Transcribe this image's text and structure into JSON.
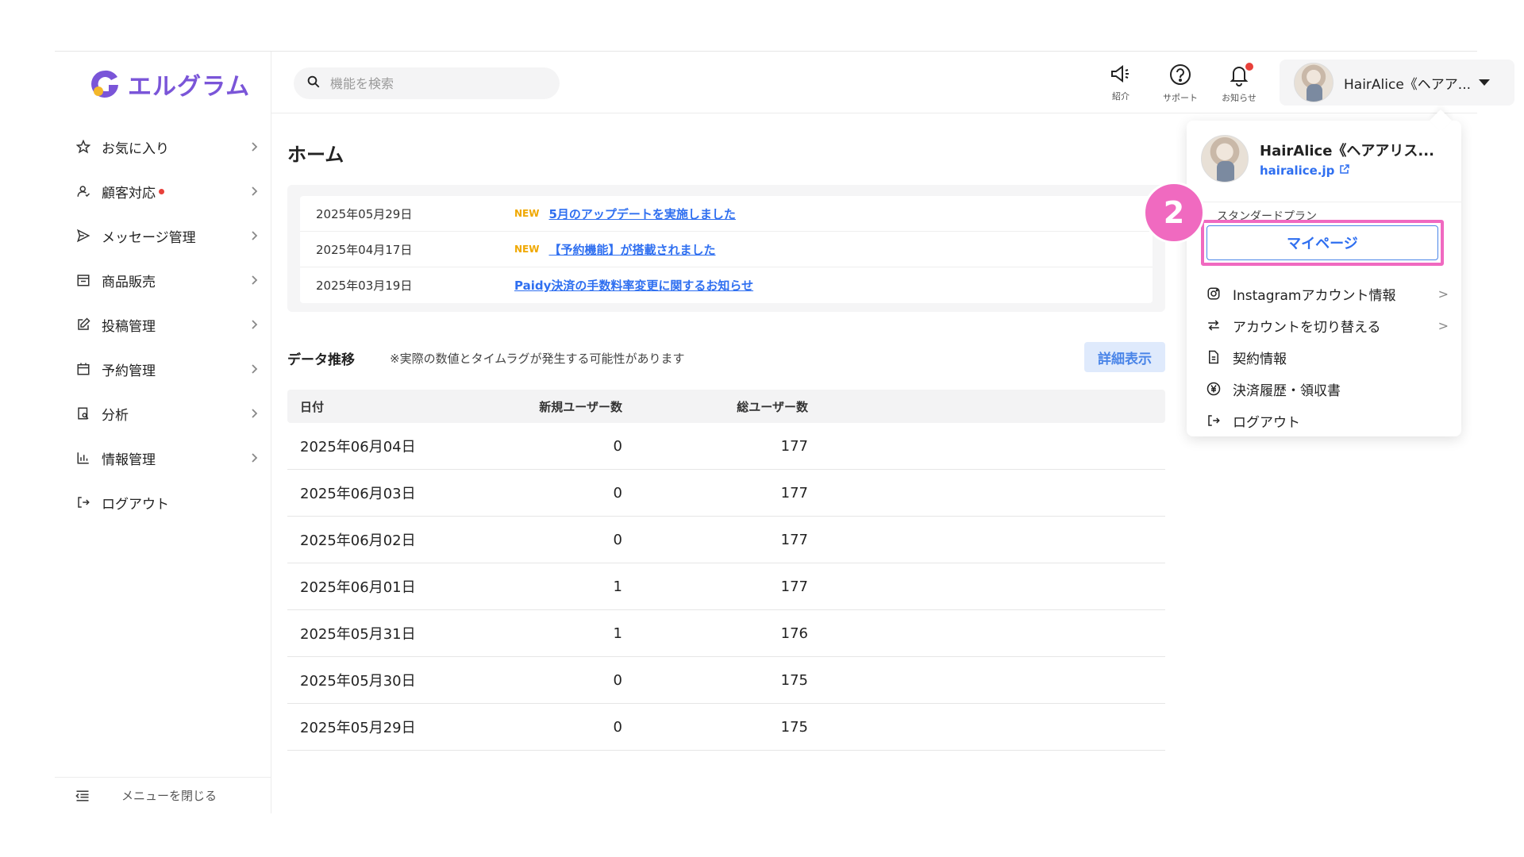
{
  "brand": {
    "name": "エルグラム",
    "color": "#7a55d8"
  },
  "search": {
    "placeholder": "機能を検索"
  },
  "header": {
    "buttons": [
      {
        "label": "紹介",
        "icon": "megaphone-icon"
      },
      {
        "label": "サポート",
        "icon": "question-circle-icon"
      },
      {
        "label": "お知らせ",
        "icon": "bell-icon"
      }
    ],
    "account_name": "HairAlice《ヘアア..."
  },
  "sidebar": {
    "items": [
      {
        "label": "お気に入り",
        "icon": "star-icon"
      },
      {
        "label": "顧客対応",
        "icon": "user-icon"
      },
      {
        "label": "メッセージ管理",
        "icon": "send-icon"
      },
      {
        "label": "商品販売",
        "icon": "shop-icon"
      },
      {
        "label": "投稿管理",
        "icon": "edit-icon"
      },
      {
        "label": "予約管理",
        "icon": "calendar-icon"
      },
      {
        "label": "分析",
        "icon": "report-icon"
      },
      {
        "label": "情報管理",
        "icon": "bar-chart-icon"
      },
      {
        "label": "ログアウト",
        "icon": "logout-icon"
      }
    ],
    "close_label": "メニューを閉じる"
  },
  "main": {
    "title": "ホーム",
    "news": [
      {
        "date": "2025年05月29日",
        "badge": "NEW",
        "text": "5月のアップデートを実施しました"
      },
      {
        "date": "2025年04月17日",
        "badge": "NEW",
        "text": "【予約機能】が搭載されました"
      },
      {
        "date": "2025年03月19日",
        "badge": "",
        "text": "Paidy決済の手数料率変更に関するお知らせ"
      }
    ],
    "data_title": "データ推移",
    "data_note": "※実際の数値とタイムラグが発生する可能性があります",
    "detail_label": "詳細表示",
    "table": {
      "headers": [
        "日付",
        "新規ユーザー数",
        "総ユーザー数"
      ],
      "rows": [
        [
          "2025年06月04日",
          "0",
          "177"
        ],
        [
          "2025年06月03日",
          "0",
          "177"
        ],
        [
          "2025年06月02日",
          "0",
          "177"
        ],
        [
          "2025年06月01日",
          "1",
          "177"
        ],
        [
          "2025年05月31日",
          "1",
          "176"
        ],
        [
          "2025年05月30日",
          "0",
          "175"
        ],
        [
          "2025年05月29日",
          "0",
          "175"
        ]
      ]
    }
  },
  "dropdown": {
    "name": "HairAlice《ヘアアリス...",
    "url": "hairalice.jp",
    "plan": "スタンダードプラン",
    "mypage_label": "マイページ",
    "items": [
      {
        "label": "Instagramアカウント情報",
        "icon": "instagram-icon"
      },
      {
        "label": "アカウントを切り替える",
        "icon": "switch-icon"
      },
      {
        "label": "契約情報",
        "icon": "document-icon"
      },
      {
        "label": "決済履歴・領収書",
        "icon": "yen-icon"
      },
      {
        "label": "ログアウト",
        "icon": "logout-icon"
      }
    ]
  },
  "step_badge": "2",
  "colors": {
    "accent": "#2f6ff0",
    "highlight": "#f069c0",
    "new_badge": "#f0a800",
    "alert": "#e8403a"
  }
}
